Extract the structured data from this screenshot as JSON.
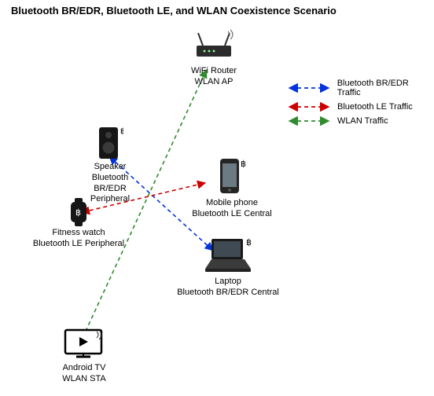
{
  "title": "Bluetooth BR/EDR, Bluetooth LE, and WLAN Coexistence Scenario",
  "legend": {
    "bredr": "Bluetooth BR/EDR Traffic",
    "le": "Bluetooth LE Traffic",
    "wlan": "WLAN Traffic"
  },
  "nodes": {
    "router": {
      "l1": "WiFi Router",
      "l2": "WLAN AP"
    },
    "speaker": {
      "l1": "Speaker",
      "l2": "Bluetooth BR/EDR",
      "l3": "Peripheral"
    },
    "watch": {
      "l1": "Fitness watch",
      "l2": "Bluetooth LE Peripheral"
    },
    "phone": {
      "l1": "Mobile phone",
      "l2": "Bluetooth LE Central"
    },
    "laptop": {
      "l1": "Laptop",
      "l2": "Bluetooth BR/EDR Central"
    },
    "tv": {
      "l1": "Android TV",
      "l2": "WLAN STA"
    }
  },
  "colors": {
    "bredr": "#0033dd",
    "le": "#cc0000",
    "wlan": "#2e8b2e"
  }
}
